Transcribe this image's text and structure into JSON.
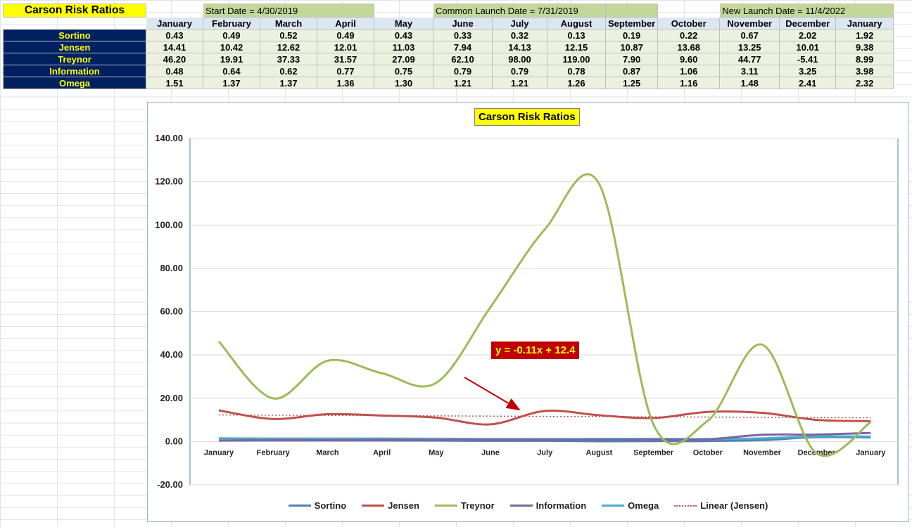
{
  "sheet": {
    "title": "Carson Risk Ratios",
    "launches": [
      {
        "label": "Start Date = 4/30/2019"
      },
      {
        "label": "Common Launch Date = 7/31/2019"
      },
      {
        "label": "New Launch Date = 11/4/2022"
      }
    ],
    "months": [
      "January",
      "February",
      "March",
      "April",
      "May",
      "June",
      "July",
      "August",
      "September",
      "October",
      "November",
      "December",
      "January"
    ],
    "rows": [
      {
        "label": "Sortino",
        "values": [
          "0.43",
          "0.49",
          "0.52",
          "0.49",
          "0.43",
          "0.33",
          "0.32",
          "0.13",
          "0.19",
          "0.22",
          "0.67",
          "2.02",
          "1.92"
        ]
      },
      {
        "label": "Jensen",
        "values": [
          "14.41",
          "10.42",
          "12.62",
          "12.01",
          "11.03",
          "7.94",
          "14.13",
          "12.15",
          "10.87",
          "13.68",
          "13.25",
          "10.01",
          "9.38"
        ]
      },
      {
        "label": "Treynor",
        "values": [
          "46.20",
          "19.91",
          "37.33",
          "31.57",
          "27.09",
          "62.10",
          "98.00",
          "119.00",
          "7.90",
          "9.60",
          "44.77",
          "-5.41",
          "8.99"
        ]
      },
      {
        "label": "Information",
        "values": [
          "0.48",
          "0.64",
          "0.62",
          "0.77",
          "0.75",
          "0.79",
          "0.79",
          "0.78",
          "0.87",
          "1.06",
          "3.11",
          "3.25",
          "3.98"
        ]
      },
      {
        "label": "Omega",
        "values": [
          "1.51",
          "1.37",
          "1.37",
          "1.36",
          "1.30",
          "1.21",
          "1.21",
          "1.26",
          "1.25",
          "1.16",
          "1.48",
          "2.41",
          "2.32"
        ]
      }
    ]
  },
  "chart_data": {
    "type": "line",
    "title": "Carson Risk Ratios",
    "categories": [
      "January",
      "February",
      "March",
      "April",
      "May",
      "June",
      "July",
      "August",
      "September",
      "October",
      "November",
      "December",
      "January"
    ],
    "ylim": [
      -20,
      140
    ],
    "yticks": [
      "-20.00",
      "0.00",
      "20.00",
      "40.00",
      "60.00",
      "80.00",
      "100.00",
      "120.00",
      "140.00"
    ],
    "series": [
      {
        "name": "Sortino",
        "color": "#4f81bd",
        "values": [
          0.43,
          0.49,
          0.52,
          0.49,
          0.43,
          0.33,
          0.32,
          0.13,
          0.19,
          0.22,
          0.67,
          2.02,
          1.92
        ]
      },
      {
        "name": "Jensen",
        "color": "#c0504d",
        "values": [
          14.41,
          10.42,
          12.62,
          12.01,
          11.03,
          7.94,
          14.13,
          12.15,
          10.87,
          13.68,
          13.25,
          10.01,
          9.38
        ]
      },
      {
        "name": "Treynor",
        "color": "#9bbb59",
        "values": [
          46.2,
          19.91,
          37.33,
          31.57,
          27.09,
          62.1,
          98.0,
          119.0,
          7.9,
          9.6,
          44.77,
          -5.41,
          8.99
        ]
      },
      {
        "name": "Information",
        "color": "#8064a2",
        "values": [
          0.48,
          0.64,
          0.62,
          0.77,
          0.75,
          0.79,
          0.79,
          0.78,
          0.87,
          1.06,
          3.11,
          3.25,
          3.98
        ]
      },
      {
        "name": "Omega",
        "color": "#4bacc6",
        "values": [
          1.51,
          1.37,
          1.37,
          1.36,
          1.3,
          1.21,
          1.21,
          1.26,
          1.25,
          1.16,
          1.48,
          2.41,
          2.32
        ]
      }
    ],
    "trendline": {
      "name": "Linear (Jensen)",
      "color": "#c0504d",
      "slope": -0.11,
      "intercept": 12.4
    },
    "annotation": "y = -0.11x + 12.4",
    "grid": true,
    "legend_position": "bottom"
  }
}
